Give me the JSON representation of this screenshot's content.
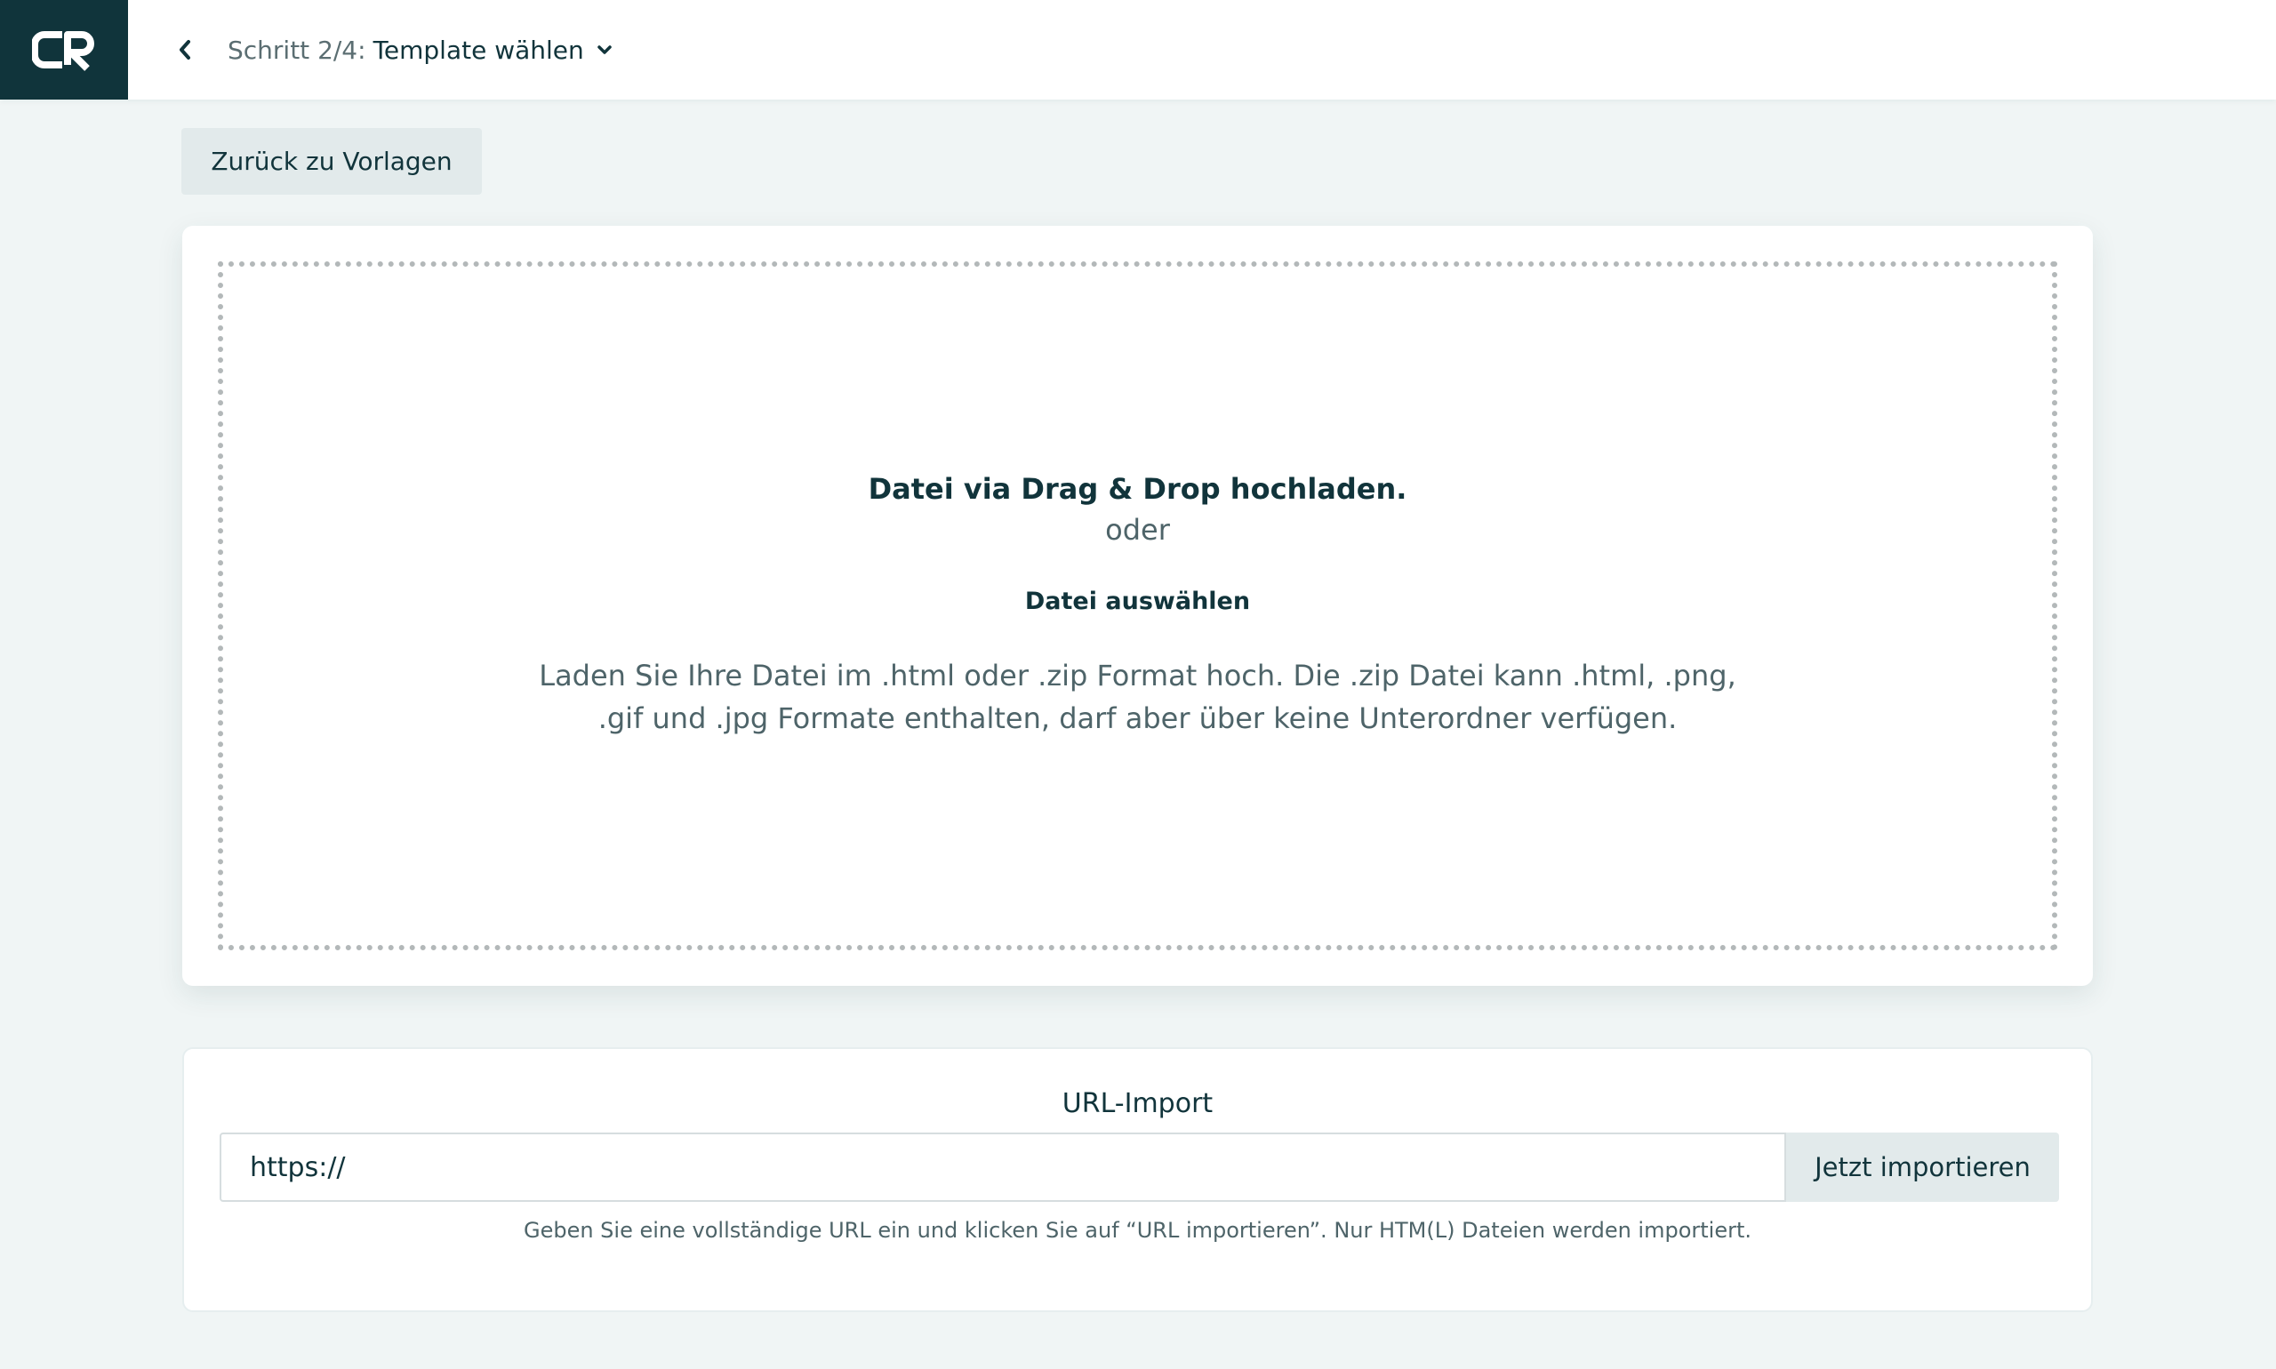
{
  "header": {
    "logo_text": "CR",
    "step_prefix": "Schritt 2/4:",
    "step_name": "Template wählen"
  },
  "toolbar": {
    "back_to_templates_label": "Zurück zu Vorlagen"
  },
  "upload": {
    "title": "Datei via Drag & Drop hochladen.",
    "or_text": "oder",
    "select_label": "Datei auswählen",
    "hint": "Laden Sie Ihre Datei im .html oder .zip Format hoch. Die .zip Datei kann .html, .png, .gif und .jpg Formate enthalten, darf aber über keine Unterordner verfügen."
  },
  "url_import": {
    "label": "URL-Import",
    "input_value": "https://",
    "button_label": "Jetzt importieren",
    "help_text": "Geben Sie eine vollständige URL ein und klicken Sie auf “URL importieren”. Nur HTM(L) Dateien werden importiert."
  },
  "colors": {
    "brand_dark": "#10343b",
    "page_background": "#f0f5f5",
    "button_background": "#e2eaeb"
  },
  "icons": {
    "logo": "cr-logo",
    "back": "chevron-left-icon",
    "dropdown": "chevron-down-icon"
  }
}
